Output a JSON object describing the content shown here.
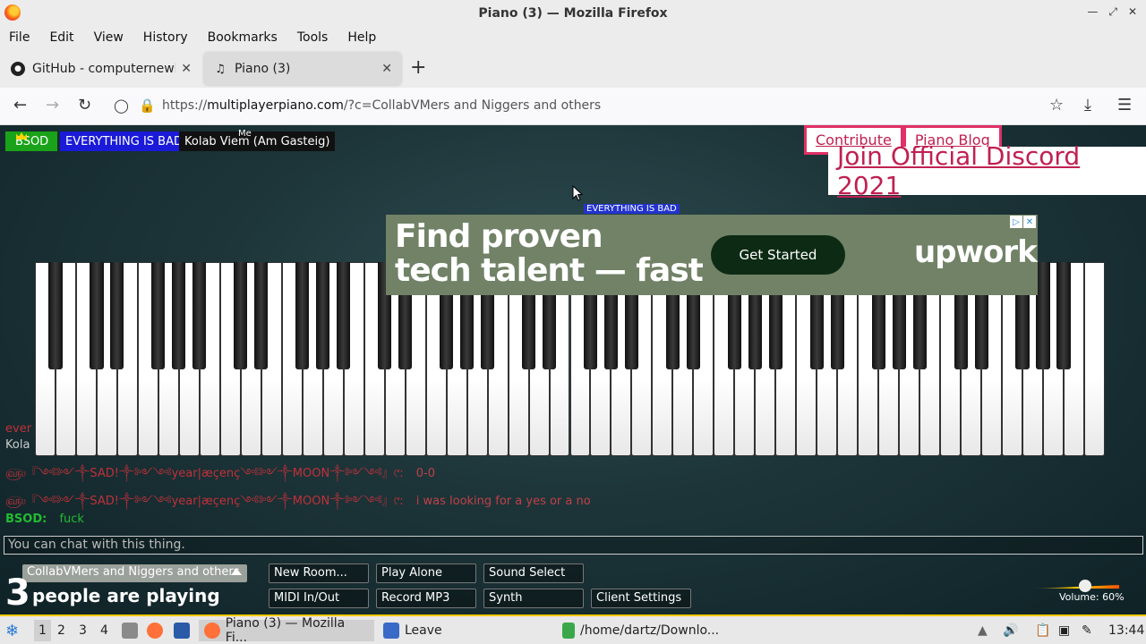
{
  "window": {
    "title": "Piano (3) — Mozilla Firefox"
  },
  "menu": [
    "File",
    "Edit",
    "View",
    "History",
    "Bookmarks",
    "Tools",
    "Help"
  ],
  "tabs": [
    {
      "label": "GitHub - computernewb/",
      "icon": "github-icon",
      "active": false
    },
    {
      "label": "Piano (3)",
      "icon": "piano-icon",
      "active": true
    }
  ],
  "url": {
    "prefix": "https://",
    "domain": "multiplayerpiano.com",
    "rest": "/?c=CollabVMers and Niggers and others"
  },
  "page": {
    "users": [
      {
        "name": "BSOD",
        "color": "#1aa31a"
      },
      {
        "name": "EVERYTHING IS BAD",
        "color": "#1a1ad8"
      },
      {
        "name": "Kolab Viem (Am Gasteig)",
        "color": "#111111"
      }
    ],
    "me_label": "Me",
    "links": [
      "Contribute",
      "Piano Blog"
    ],
    "discord": "Join Official Discord 2021",
    "cursor_label": "EVERYTHING IS BAD",
    "ad": {
      "headline_1": "Find proven",
      "headline_2": "tech talent — fast",
      "button": "Get Started",
      "brand": "upwork"
    },
    "chat": [
      {
        "name": "ever",
        "message": ""
      },
      {
        "name": "Kola",
        "message": ""
      },
      {
        "name": "௵『༺༻༒SAD!༒༻༺year|æçenç༺༻༒MOON༒༻༺』୯:",
        "message": "0-0"
      },
      {
        "name": "௵『༺༻༒SAD!༒༻༺year|æçenç༺༻༒MOON༒༻༺』୯:",
        "message": "i was looking for a yes or a no"
      },
      {
        "name": "BSOD:",
        "message": "fuck"
      }
    ],
    "chat_placeholder": "You can chat with this thing.",
    "room_name": "CollabVMers and Niggers and others",
    "players_count": "3",
    "players_label": "people are playing",
    "buttons": {
      "new_room": "New Room...",
      "play_alone": "Play Alone",
      "sound_select": "Sound Select",
      "midi": "MIDI In/Out",
      "record": "Record MP3",
      "synth": "Synth",
      "client_settings": "Client Settings"
    },
    "volume_label": "Volume: 60%",
    "volume": 0.6
  },
  "taskbar": {
    "workspaces": [
      "1",
      "2",
      "3",
      "4"
    ],
    "apps": [
      {
        "label": "Piano (3) — Mozilla Fi...",
        "active": true
      },
      {
        "label": "Leave",
        "active": false
      },
      {
        "label": "/home/dartz/Downlo...",
        "active": false
      }
    ],
    "clock": "13:44"
  }
}
